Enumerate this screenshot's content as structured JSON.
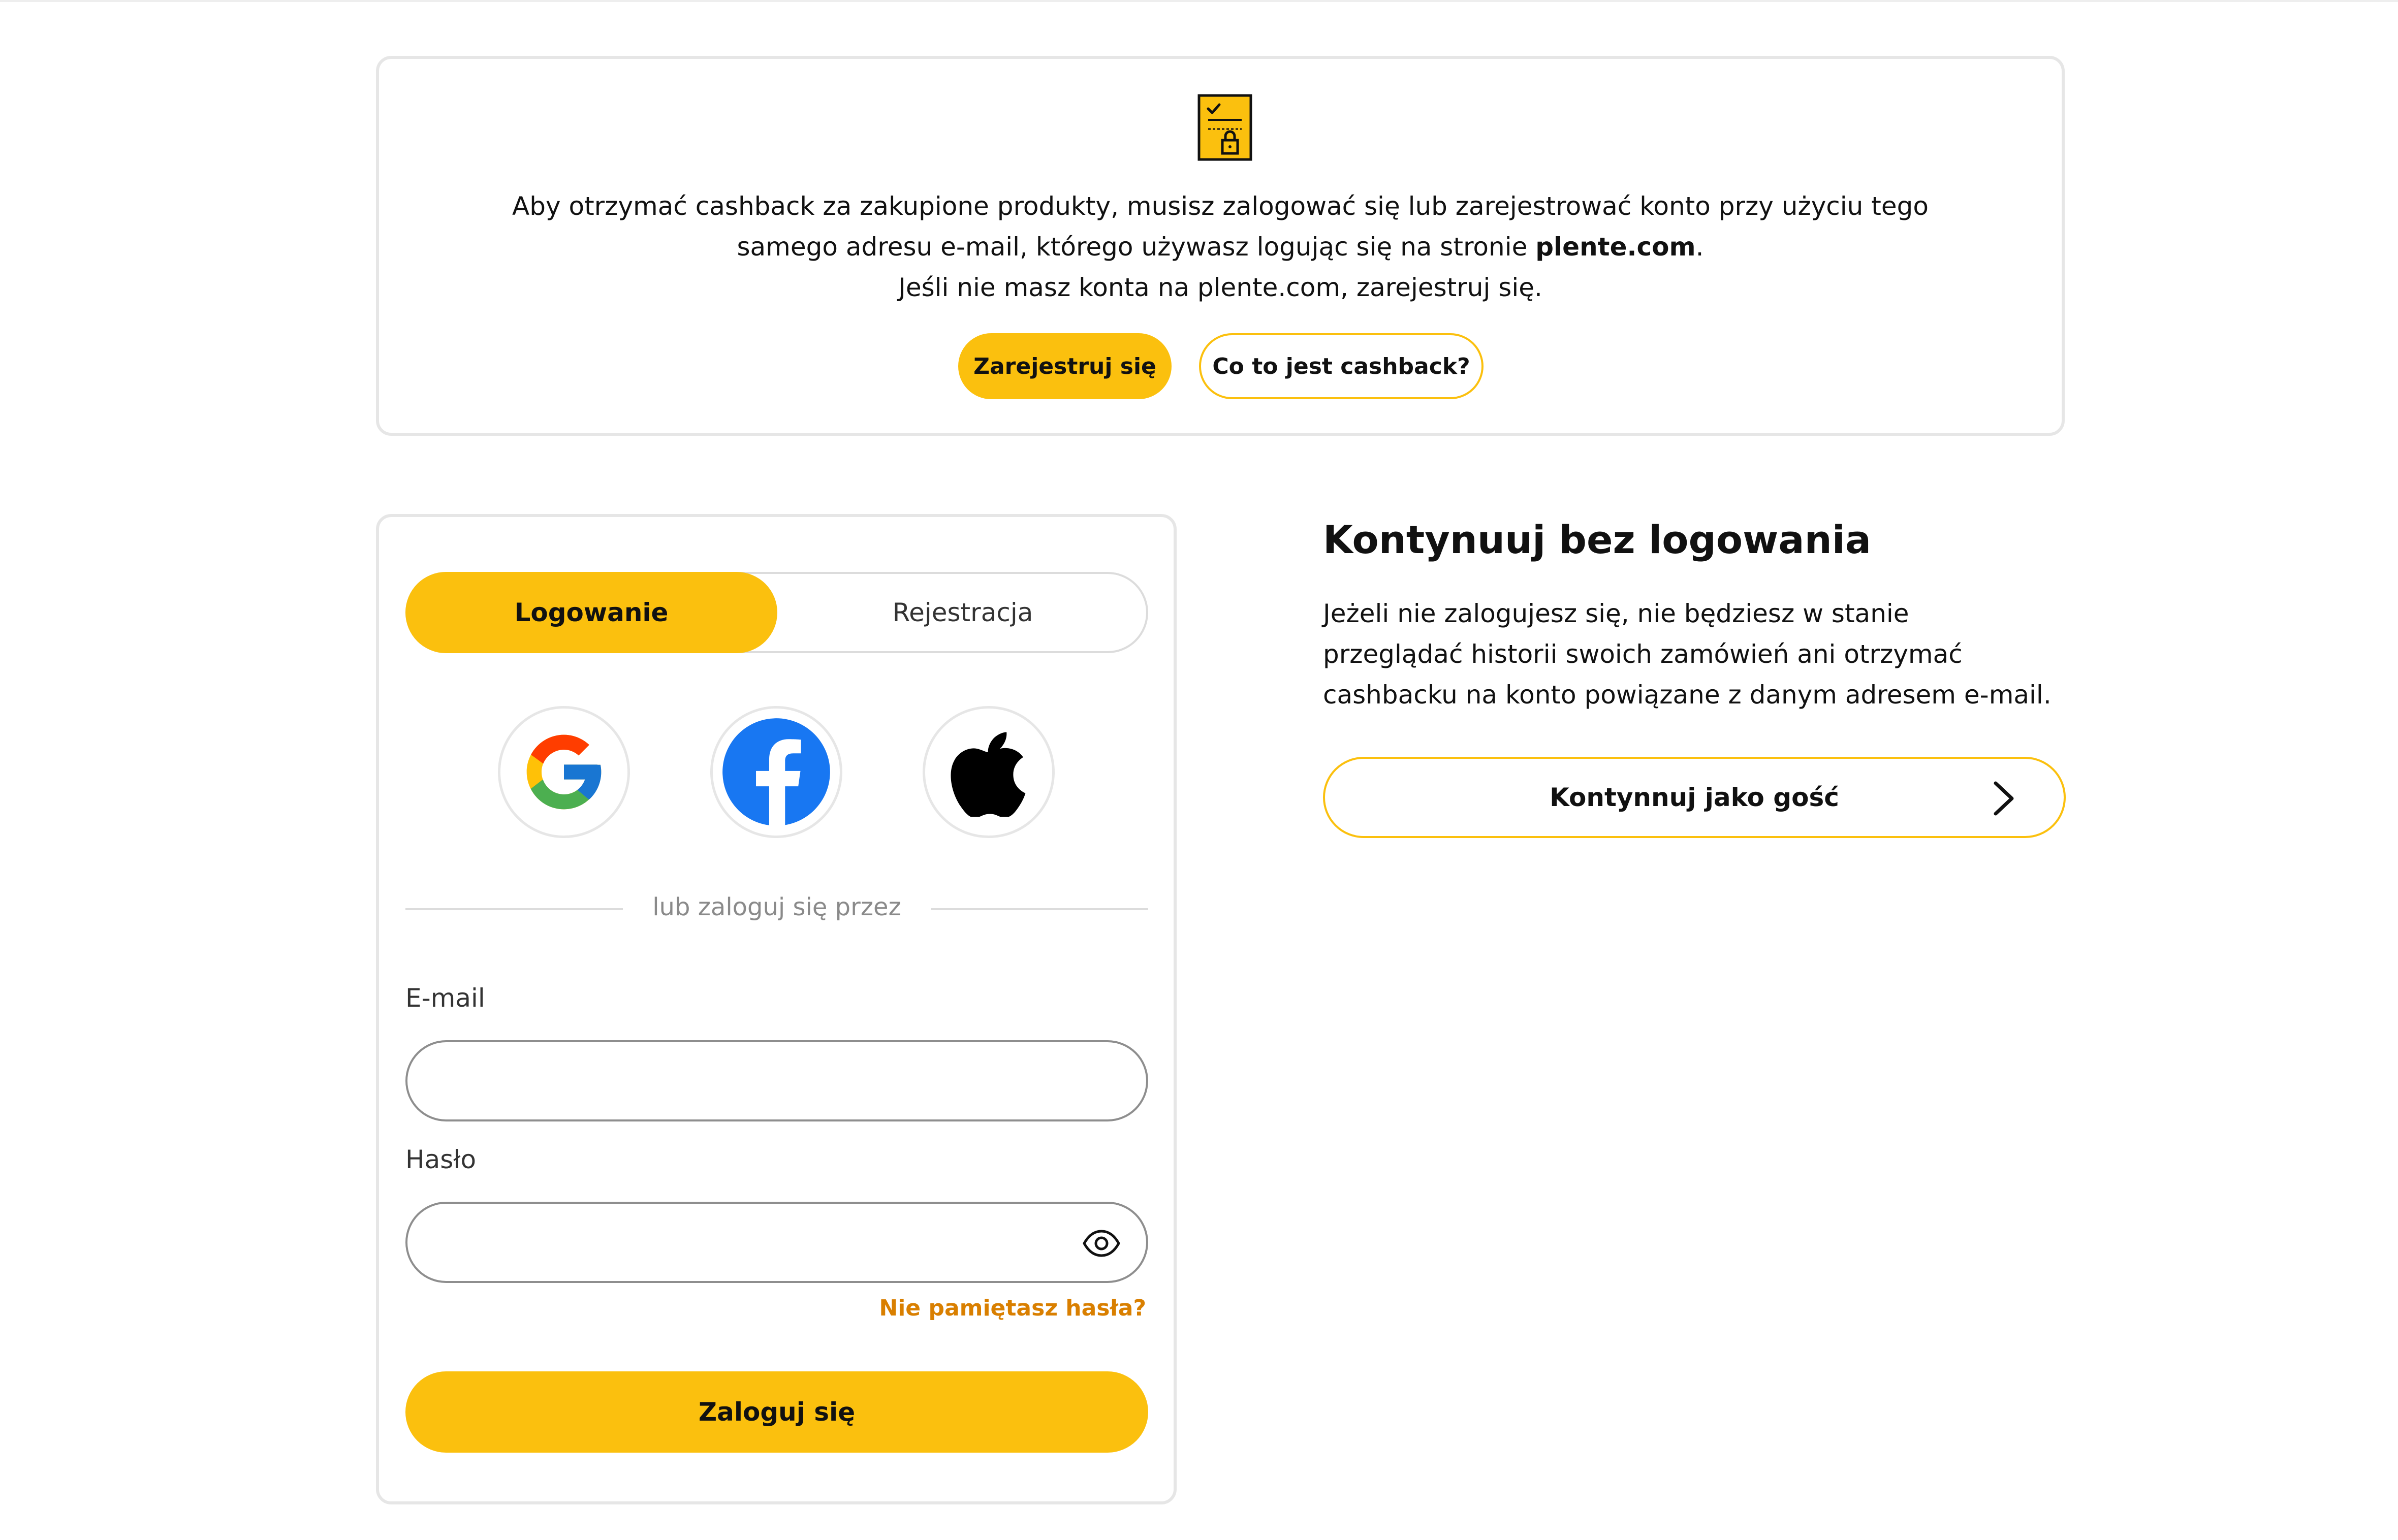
{
  "notice": {
    "line1": "Aby otrzymać cashback za zakupione produkty, musisz zalogować się lub zarejestrować konto przy użyciu tego",
    "line2_before": "samego adresu e-mail, którego używasz logując się na stronie ",
    "line2_bold": "plente.com",
    "line2_after": ".",
    "line3": "Jeśli nie masz konta na plente.com, zarejestruj się.",
    "register_label": "Zarejestruj się",
    "whatis_label": "Co to jest cashback?",
    "icon": "secure-document-icon"
  },
  "login": {
    "tabs": [
      {
        "label": "Logowanie",
        "active": true
      },
      {
        "label": "Rejestracja",
        "active": false
      }
    ],
    "social": [
      "google-icon",
      "facebook-icon",
      "apple-icon"
    ],
    "divider_text": "lub zaloguj się przez",
    "email_label": "E-mail",
    "email_value": "",
    "password_label": "Hasło",
    "password_value": "",
    "forgot_label": "Nie pamiętasz hasła?",
    "submit_label": "Zaloguj się"
  },
  "guest": {
    "title": "Kontynuuj bez logowania",
    "description": "Jeżeli nie zalogujesz się, nie będziesz w stanie przeglądać historii swoich zamówień ani otrzymać cashbacku na konto powiązane z danym adresem e-mail.",
    "button_label": "Kontynnuj jako gość"
  },
  "colors": {
    "accent": "#fbc00e",
    "link": "#d97f00",
    "border": "#e6e6e6",
    "facebook": "#1877f2"
  }
}
